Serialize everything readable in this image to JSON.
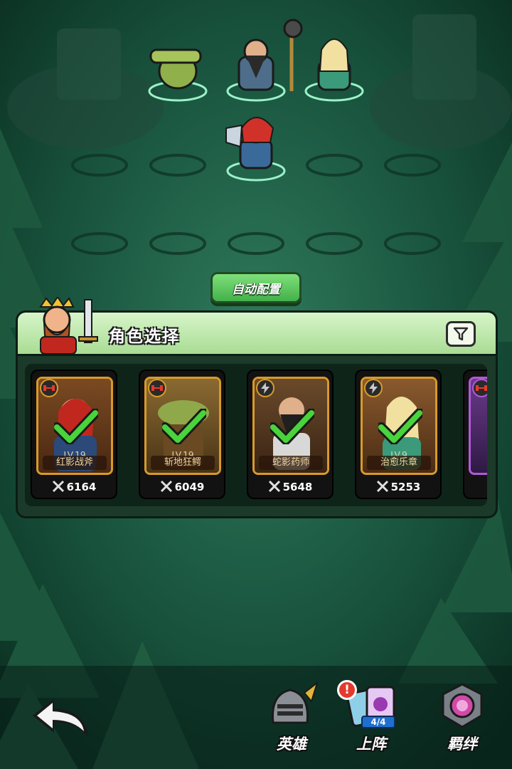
{
  "auto_config_label": "自动配置",
  "panel": {
    "title": "角色选择"
  },
  "heroes": [
    {
      "level": "LV.19",
      "name": "红影战斧",
      "power": "6164",
      "class_icon": "dumbbell-icon",
      "selected": true,
      "accent": "#d89a2a"
    },
    {
      "level": "LV.19",
      "name": "斩地狂鳄",
      "power": "6049",
      "class_icon": "dumbbell-icon",
      "selected": true,
      "accent": "#d89a2a"
    },
    {
      "level": "LV.14",
      "name": "蛇影药师",
      "power": "5648",
      "class_icon": "lightning-icon",
      "selected": true,
      "accent": "#d89a2a"
    },
    {
      "level": "LV.9",
      "name": "治愈乐章",
      "power": "5253",
      "class_icon": "lightning-icon",
      "selected": true,
      "accent": "#d89a2a"
    }
  ],
  "bottom_nav": {
    "heroes_label": "英雄",
    "deploy_label": "上阵",
    "deploy_count": "4/4",
    "deploy_alert": "!",
    "bonds_label": "羁绊"
  },
  "colors": {
    "background": "#0f3a2c",
    "button_green": "#43b04a",
    "card_gold": "#d89a2a",
    "card_purple": "#b05ad8",
    "alert_red": "#e23b2e"
  }
}
